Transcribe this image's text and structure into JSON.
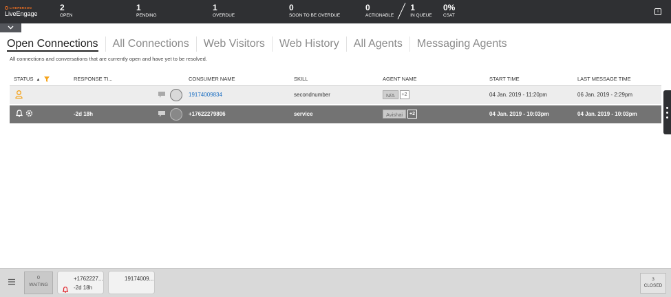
{
  "brand": {
    "company": "LIVEPERSON",
    "product": "LiveEngage"
  },
  "stats": [
    {
      "value": "2",
      "label": "OPEN"
    },
    {
      "value": "1",
      "label": "PENDING"
    },
    {
      "value": "1",
      "label": "OVERDUE"
    },
    {
      "value": "0",
      "label": "SOON TO BE OVERDUE"
    },
    {
      "value": "0",
      "label": "ACTIONABLE"
    },
    {
      "value": "1",
      "label": "IN QUEUE"
    },
    {
      "value": "0%",
      "label": "CSAT"
    }
  ],
  "tabs": [
    "Open Connections",
    "All Connections",
    "Web Visitors",
    "Web History",
    "All Agents",
    "Messaging Agents"
  ],
  "subtitle": "All connections and conversations that are currently open and have yet to be resolved.",
  "table": {
    "headers": [
      "STATUS",
      "RESPONSE TI...",
      "CONSUMER NAME",
      "SKILL",
      "AGENT NAME",
      "START TIME",
      "LAST MESSAGE TIME"
    ],
    "rows": [
      {
        "status_icon": "person-icon",
        "response_time": "",
        "consumer": "19174009834",
        "skill": "secondnumber",
        "agent": "N/A",
        "agent_extra": "+2",
        "start": "04 Jan. 2019 - 11:20pm",
        "last_message": "06 Jan. 2019 - 2:29pm"
      },
      {
        "status_icon": "bell-icon",
        "response_time": "-2d 18h",
        "consumer": "+17622279806",
        "skill": "service",
        "agent": "Avishai",
        "agent_extra": "+2",
        "start": "04 Jan. 2019 - 10:03pm",
        "last_message": "04 Jan. 2019 - 10:03pm"
      }
    ]
  },
  "bottom": {
    "waiting_count": "0",
    "waiting_label": "WAITING",
    "cards": [
      {
        "title": "+1762227...",
        "sub": "-2d 18h"
      },
      {
        "title": "19174009...",
        "sub": ""
      }
    ],
    "closed_count": "3",
    "closed_label": "CLOSED"
  },
  "colors": {
    "topbar": "#2f3033",
    "accent": "#f37021",
    "link": "#1a6ec2",
    "selected_row": "#737373"
  }
}
